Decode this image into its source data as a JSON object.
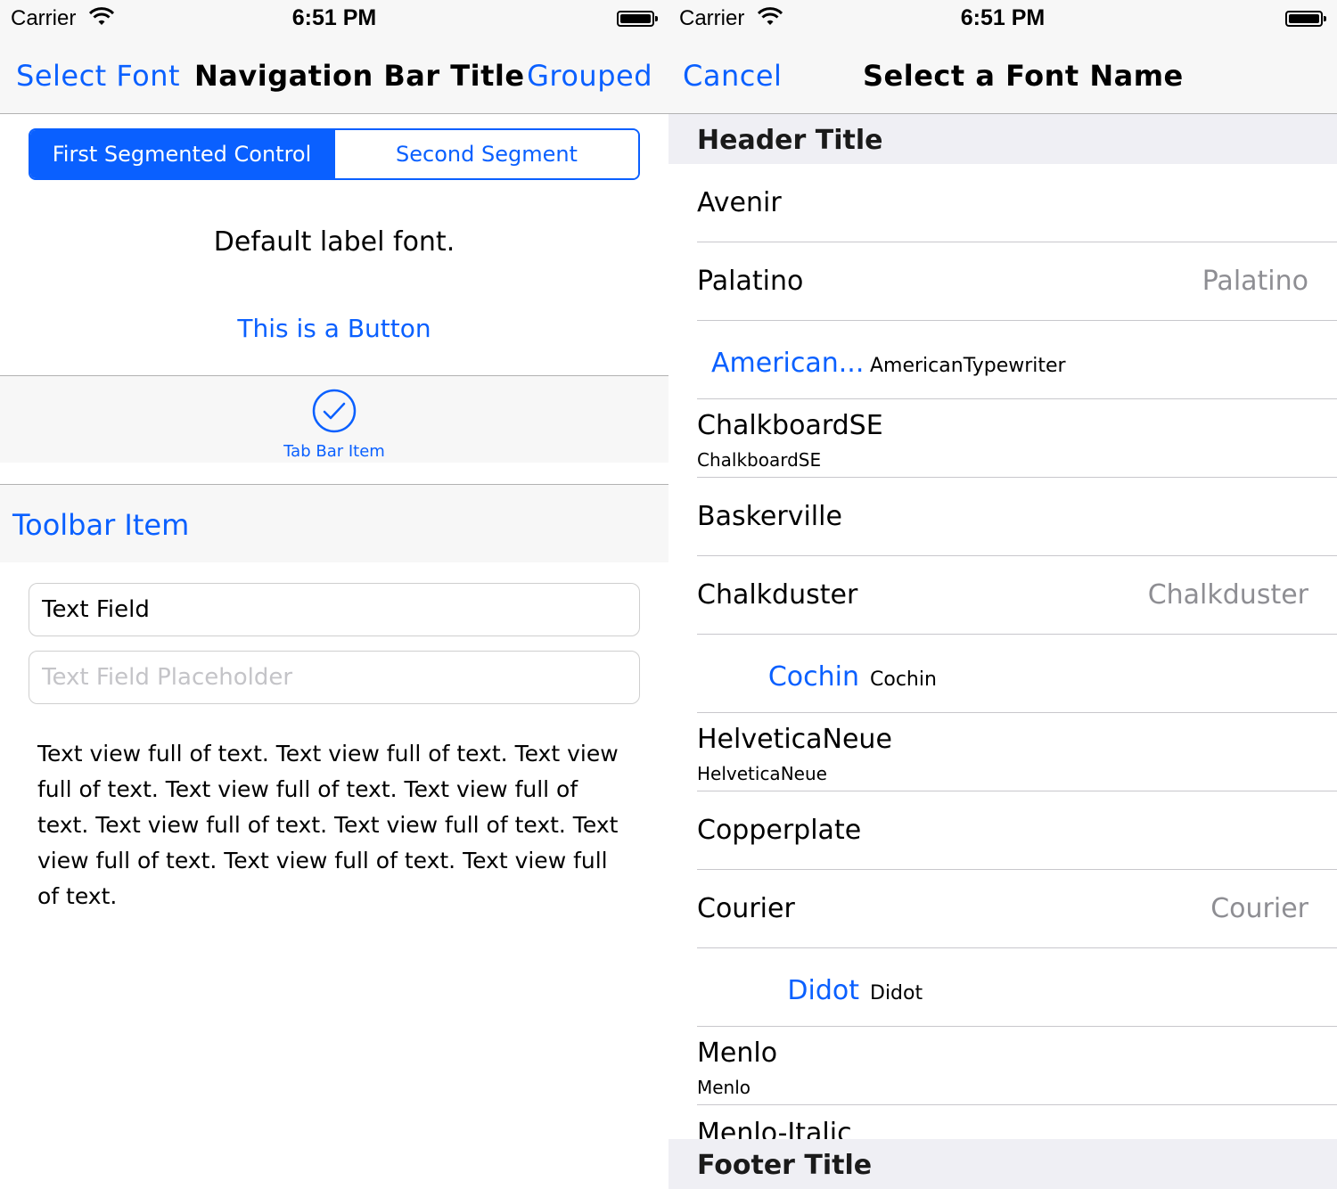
{
  "left_screen": {
    "status_bar": {
      "carrier": "Carrier",
      "time": "6:51 PM"
    },
    "nav": {
      "left_button": "Select Font",
      "title": "Navigation Bar Title",
      "right_button": "Grouped"
    },
    "segmented_control": {
      "segments": [
        "First Segmented Control",
        "Second Segment"
      ],
      "selected_index": 0
    },
    "default_label": "Default label font.",
    "button_label": "This is a Button",
    "tab_bar": {
      "item_label": "Tab Bar Item",
      "icon": "checkmark-circle-icon"
    },
    "toolbar": {
      "item_label": "Toolbar Item"
    },
    "text_field": {
      "value": "Text Field"
    },
    "text_field_placeholder": {
      "placeholder": "Text Field Placeholder"
    },
    "text_view": "Text view full of text. Text view full of text. Text view full of text. Text view full of text. Text view full of text. Text view full of text. Text view full of text. Text view full of text. Text view full of text. Text view full of text.",
    "accent_color": "#0a60ff"
  },
  "right_screen": {
    "status_bar": {
      "carrier": "Carrier",
      "time": "6:51 PM"
    },
    "nav": {
      "left_button": "Cancel",
      "title": "Select a Font Name"
    },
    "header_title": "Header Title",
    "footer_title": "Footer Title",
    "rows": [
      {
        "style": "default",
        "title": "Avenir"
      },
      {
        "style": "value1",
        "title": "Palatino",
        "detail": "Palatino"
      },
      {
        "style": "value2",
        "title": "American...",
        "detail": "AmericanTypewriter"
      },
      {
        "style": "subtitle",
        "title": "ChalkboardSE",
        "detail": "ChalkboardSE"
      },
      {
        "style": "default",
        "title": "Baskerville"
      },
      {
        "style": "value1",
        "title": "Chalkduster",
        "detail": "Chalkduster"
      },
      {
        "style": "value2",
        "title": "Cochin",
        "detail": "Cochin"
      },
      {
        "style": "subtitle",
        "title": "HelveticaNeue",
        "detail": "HelveticaNeue"
      },
      {
        "style": "default",
        "title": "Copperplate"
      },
      {
        "style": "value1",
        "title": "Courier",
        "detail": "Courier"
      },
      {
        "style": "value2",
        "title": "Didot",
        "detail": "Didot"
      },
      {
        "style": "subtitle",
        "title": "Menlo",
        "detail": "Menlo"
      },
      {
        "style": "default",
        "title": "Menlo-Italic"
      }
    ]
  }
}
